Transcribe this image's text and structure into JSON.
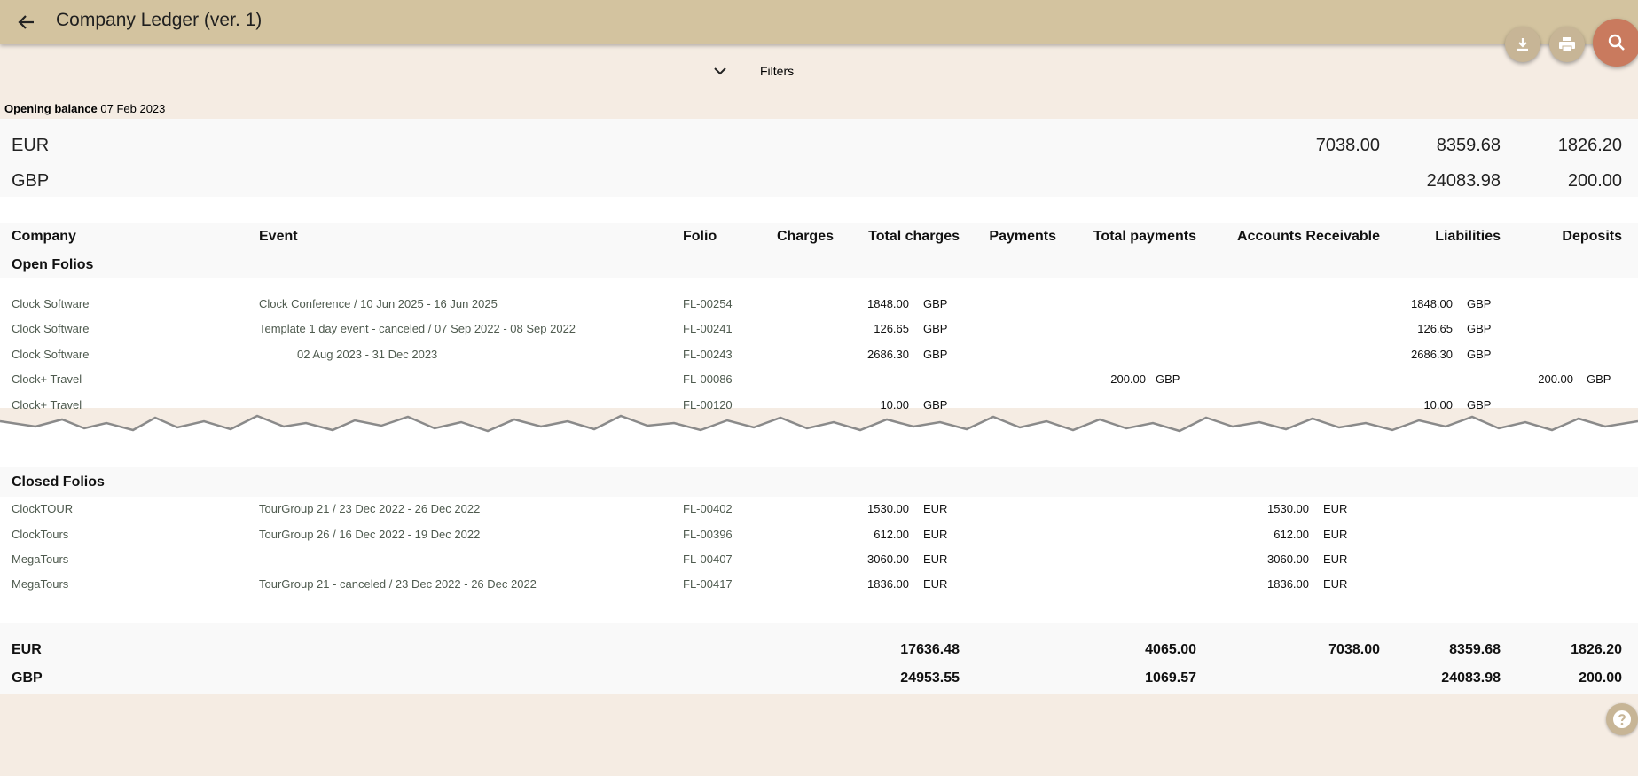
{
  "header": {
    "title": "Company Ledger (ver. 1)"
  },
  "filters": {
    "label": "Filters"
  },
  "opening": {
    "label": "Opening balance",
    "date": "07 Feb 2023"
  },
  "summary": [
    {
      "currency": "EUR",
      "accounts_receivable": "7038.00",
      "liabilities": "8359.68",
      "deposits": "1826.20"
    },
    {
      "currency": "GBP",
      "accounts_receivable": "",
      "liabilities": "24083.98",
      "deposits": "200.00"
    }
  ],
  "columns": {
    "company": "Company",
    "event": "Event",
    "folio": "Folio",
    "charges": "Charges",
    "total_charges": "Total charges",
    "payments": "Payments",
    "total_payments": "Total payments",
    "accounts_receivable": "Accounts Receivable",
    "liabilities": "Liabilities",
    "deposits": "Deposits"
  },
  "open_folios": {
    "title": "Open Folios",
    "rows": [
      {
        "company": "Clock Software",
        "event": "Clock Conference / 10 Jun 2025 - 16 Jun 2025",
        "folio": "FL-00254",
        "total_charges": "1848.00",
        "tc_cur": "GBP",
        "total_payments": "",
        "tp_cur": "",
        "ar": "",
        "ar_cur": "",
        "liabilities": "1848.00",
        "li_cur": "GBP",
        "deposits": "",
        "de_cur": ""
      },
      {
        "company": "Clock Software",
        "event": "Template 1 day event - canceled / 07 Sep 2022 - 08 Sep 2022",
        "folio": "FL-00241",
        "total_charges": "126.65",
        "tc_cur": "GBP",
        "total_payments": "",
        "tp_cur": "",
        "ar": "",
        "ar_cur": "",
        "liabilities": "126.65",
        "li_cur": "GBP",
        "deposits": "",
        "de_cur": ""
      },
      {
        "company": "Clock Software",
        "event": "02 Aug 2023 - 31 Dec 2023",
        "folio": "FL-00243",
        "total_charges": "2686.30",
        "tc_cur": "GBP",
        "total_payments": "",
        "tp_cur": "",
        "ar": "",
        "ar_cur": "",
        "liabilities": "2686.30",
        "li_cur": "GBP",
        "deposits": "",
        "de_cur": ""
      },
      {
        "company": "Clock+ Travel",
        "event": "",
        "folio": "FL-00086",
        "total_charges": "",
        "tc_cur": "",
        "total_payments": "200.00",
        "tp_cur": "GBP",
        "ar": "",
        "ar_cur": "",
        "liabilities": "",
        "li_cur": "",
        "deposits": "200.00",
        "de_cur": "GBP"
      },
      {
        "company": "Clock+ Travel",
        "event": "",
        "folio": "FL-00120",
        "total_charges": "10.00",
        "tc_cur": "GBP",
        "total_payments": "",
        "tp_cur": "",
        "ar": "",
        "ar_cur": "",
        "liabilities": "10.00",
        "li_cur": "GBP",
        "deposits": "",
        "de_cur": ""
      }
    ]
  },
  "closed_folios": {
    "title": "Closed Folios",
    "rows": [
      {
        "company": "ClockTOUR",
        "event": "TourGroup 21 / 23 Dec 2022 - 26 Dec 2022",
        "folio": "FL-00402",
        "total_charges": "1530.00",
        "tc_cur": "EUR",
        "ar": "1530.00",
        "ar_cur": "EUR"
      },
      {
        "company": "ClockTours",
        "event": "TourGroup 26 / 16 Dec 2022 - 19 Dec 2022",
        "folio": "FL-00396",
        "total_charges": "612.00",
        "tc_cur": "EUR",
        "ar": "612.00",
        "ar_cur": "EUR"
      },
      {
        "company": "MegaTours",
        "event": "",
        "folio": "FL-00407",
        "total_charges": "3060.00",
        "tc_cur": "EUR",
        "ar": "3060.00",
        "ar_cur": "EUR"
      },
      {
        "company": "MegaTours",
        "event": "TourGroup 21 - canceled / 23 Dec 2022 - 26 Dec 2022",
        "folio": "FL-00417",
        "total_charges": "1836.00",
        "tc_cur": "EUR",
        "ar": "1836.00",
        "ar_cur": "EUR"
      }
    ]
  },
  "totals": [
    {
      "currency": "EUR",
      "total_charges": "17636.48",
      "total_payments": "4065.00",
      "ar": "7038.00",
      "liabilities": "8359.68",
      "deposits": "1826.20"
    },
    {
      "currency": "GBP",
      "total_charges": "24953.55",
      "total_payments": "1069.57",
      "ar": "",
      "liabilities": "24083.98",
      "deposits": "200.00"
    }
  ],
  "icons": {
    "back": "arrow-left-icon",
    "download": "download-icon",
    "print": "print-icon",
    "search": "search-icon",
    "filters": "chevron-down-icon",
    "help": "help-icon"
  },
  "colors": {
    "topbar": "#d3c39f",
    "background": "#f5ece3",
    "search_fab": "#c97a5e"
  }
}
